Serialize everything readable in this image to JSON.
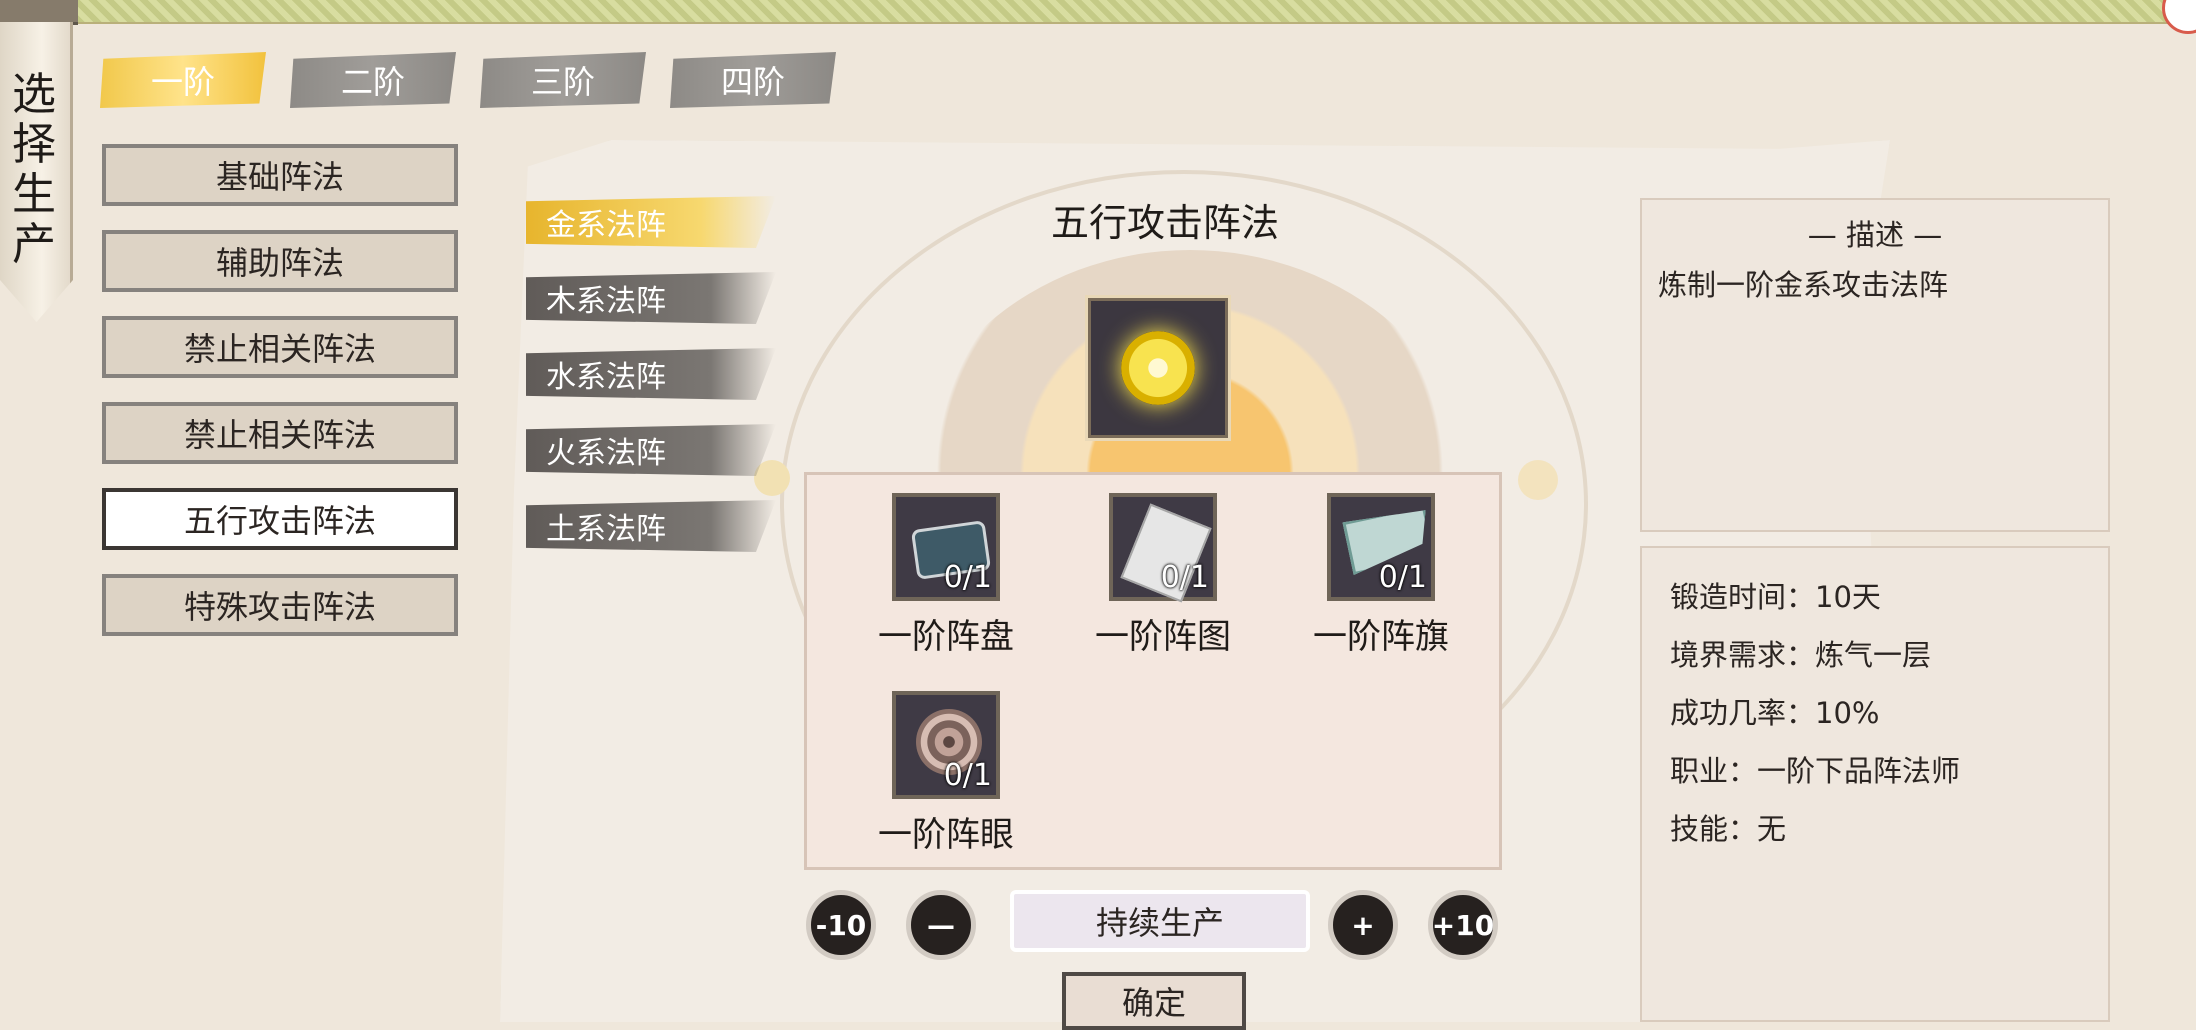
{
  "scroll": {
    "title": "选择生产"
  },
  "tiers": [
    "一阶",
    "二阶",
    "三阶",
    "四阶"
  ],
  "categories": [
    "基础阵法",
    "辅助阵法",
    "禁止相关阵法",
    "禁止相关阵法",
    "五行攻击阵法",
    "特殊攻击阵法"
  ],
  "element_types": [
    "金系法阵",
    "木系法阵",
    "水系法阵",
    "火系法阵",
    "土系法阵"
  ],
  "recipe": {
    "title": "五行攻击阵法",
    "icon": "golden-array-icon"
  },
  "materials": [
    {
      "name": "一阶阵盘",
      "count": "0/1",
      "icon": "array-disc-icon"
    },
    {
      "name": "一阶阵图",
      "count": "0/1",
      "icon": "array-diagram-icon"
    },
    {
      "name": "一阶阵旗",
      "count": "0/1",
      "icon": "array-flag-icon"
    },
    {
      "name": "一阶阵眼",
      "count": "0/1",
      "icon": "array-eye-icon"
    }
  ],
  "controls": {
    "minus10": "-10",
    "minus": "—",
    "production_mode": "持续生产",
    "plus": "+",
    "plus10": "+10",
    "confirm": "确定"
  },
  "description": {
    "heading": "— 描述 —",
    "text": "炼制一阶金系攻击法阵"
  },
  "info": {
    "forging_time": "锻造时间：10天",
    "realm_requirement": "境界需求：炼气一层",
    "success_rate": "成功几率：10%",
    "profession": "职业：一阶下品阵法师",
    "skill": "技能：无"
  },
  "colors": {
    "tier_active": "#f2c84b",
    "tier_inactive": "#8d8a86",
    "panel_bg": "#f4e7df",
    "ink": "#2b2522"
  }
}
